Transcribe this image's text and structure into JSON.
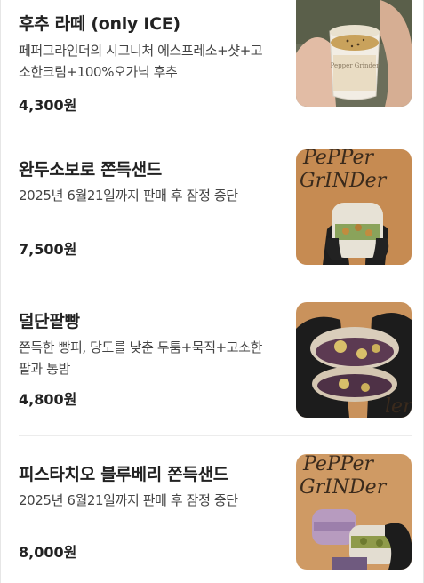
{
  "menu": {
    "items": [
      {
        "name": "후추 라떼 (only ICE)",
        "description": "페퍼그라인더의 시그니처 에스프레소+샷+고소한크림+100%오가닉 후추",
        "price": "4,300원",
        "image_label": "pepper-latte-photo"
      },
      {
        "name": "완두소보로 쫀득샌드",
        "description": "2025년 6월21일까지 판매 후 잠정 중단",
        "price": "7,500원",
        "image_label": "pea-soboro-sandwich-photo"
      },
      {
        "name": "덜단팥빵",
        "description": "쫀득한 빵피, 당도를 낮춘 두툼+묵직+고소한 팥과 통밤",
        "price": "4,800원",
        "image_label": "red-bean-bread-photo"
      },
      {
        "name": "피스타치오 블루베리 쫀득샌드",
        "description": "2025년 6월21일까지 판매 후 잠정 중단",
        "price": "8,000원",
        "image_label": "pistachio-blueberry-sandwich-photo"
      }
    ]
  },
  "colors": {
    "background": "#ffffff",
    "text_primary": "#222222",
    "text_secondary": "#444444",
    "divider": "#ececec"
  }
}
